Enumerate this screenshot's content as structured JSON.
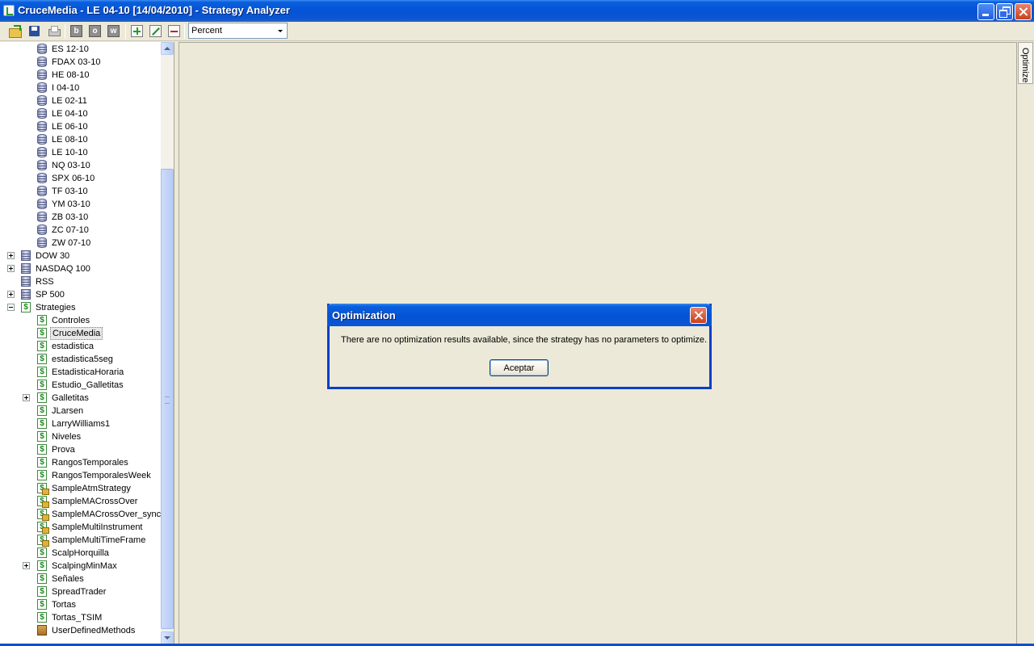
{
  "window": {
    "title": "CruceMedia - LE 04-10 [14/04/2010] - Strategy Analyzer"
  },
  "toolbar": {
    "letter_b": "b",
    "letter_o": "o",
    "letter_w": "w",
    "display_mode": "Percent"
  },
  "tree": {
    "instruments": [
      "ES 12-10",
      "FDAX 03-10",
      "HE 08-10",
      "I 04-10",
      "LE 02-11",
      "LE 04-10",
      "LE 06-10",
      "LE 08-10",
      "LE 10-10",
      "NQ 03-10",
      "SPX 06-10",
      "TF 03-10",
      "YM 03-10",
      "ZB 03-10",
      "ZC 07-10",
      "ZW 07-10"
    ],
    "lists": [
      "DOW 30",
      "NASDAQ 100",
      "RSS",
      "SP 500"
    ],
    "strategies_label": "Strategies",
    "strategies": [
      "Controles",
      "CruceMedia",
      "estadistica",
      "estadistica5seg",
      "EstadisticaHoraria",
      "Estudio_Galletitas",
      "Galletitas",
      "JLarsen",
      "LarryWilliams1",
      "Niveles",
      "Prova",
      "RangosTemporales",
      "RangosTemporalesWeek",
      "SampleAtmStrategy",
      "SampleMACrossOver",
      "SampleMACrossOver_sync",
      "SampleMultiInstrument",
      "SampleMultiTimeFrame",
      "ScalpHorquilla",
      "ScalpingMinMax",
      "Señales",
      "SpreadTrader",
      "Tortas",
      "Tortas_TSIM",
      "UserDefinedMethods"
    ],
    "selected": "CruceMedia"
  },
  "side_tab": {
    "label": "Optimize"
  },
  "dialog": {
    "title": "Optimization",
    "message": "There are no optimization results available, since the strategy has no parameters to optimize.",
    "ok_label": "Aceptar"
  }
}
